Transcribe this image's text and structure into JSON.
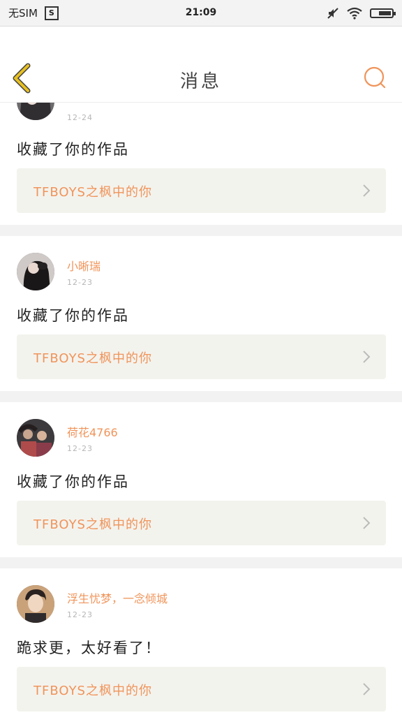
{
  "status_bar": {
    "carrier": "无SIM",
    "sim_icon_label": "S",
    "time": "21:09",
    "icons": [
      "sim-icon",
      "mute-icon",
      "wifi-icon",
      "battery-icon"
    ]
  },
  "header": {
    "title": "消息",
    "back_icon": "chevron-left-icon",
    "search_icon": "search-icon",
    "accent_color": "#f0945a",
    "back_color": "#e8c020"
  },
  "notifications": [
    {
      "username": "",
      "date": "12-24",
      "message": "收藏了你的作品",
      "work_title": "TFBOYS之枫中的你"
    },
    {
      "username": "小晰瑞",
      "date": "12-23",
      "message": "收藏了你的作品",
      "work_title": "TFBOYS之枫中的你"
    },
    {
      "username": "荷花4766",
      "date": "12-23",
      "message": "收藏了你的作品",
      "work_title": "TFBOYS之枫中的你"
    },
    {
      "username": "浮生忧梦，一念倾城",
      "date": "12-23",
      "message": "跪求更，太好看了！",
      "work_title": "TFBOYS之枫中的你"
    }
  ]
}
